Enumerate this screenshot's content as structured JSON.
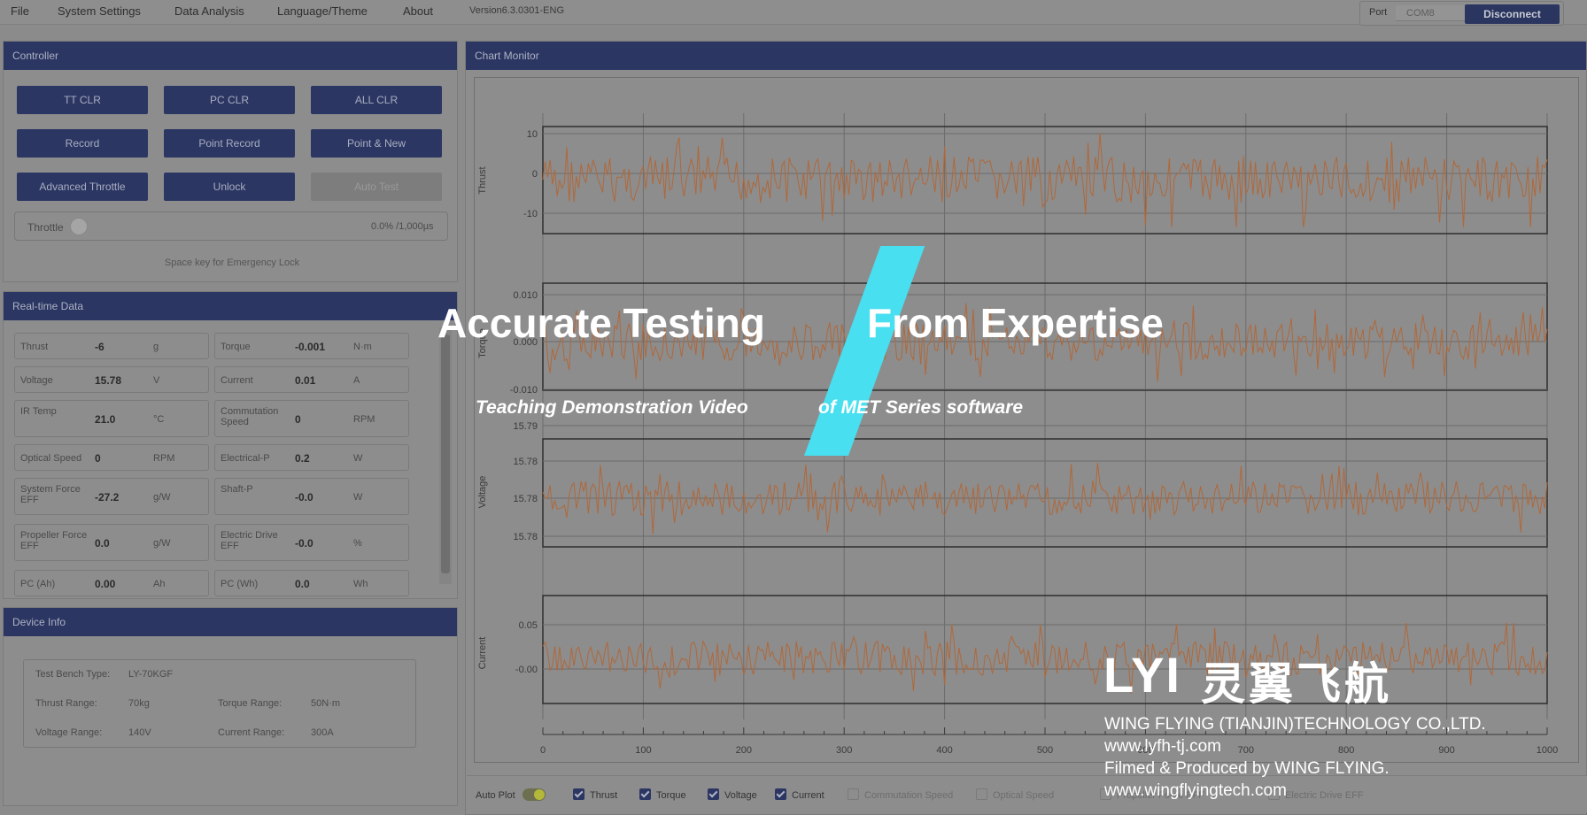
{
  "menu": {
    "file": "File",
    "system_settings": "System Settings",
    "data_analysis": "Data Analysis",
    "language_theme": "Language/Theme",
    "about": "About",
    "version": "Version6.3.0301-ENG"
  },
  "port": {
    "label": "Port",
    "value": "COM8",
    "disconnect": "Disconnect"
  },
  "controller": {
    "title": "Controller",
    "buttons": [
      "TT CLR",
      "PC CLR",
      "ALL CLR",
      "Record",
      "Point Record",
      "Point & New",
      "Advanced Throttle",
      "Unlock",
      "Auto Test"
    ],
    "throttle_label": "Throttle",
    "throttle_value": "0.0%",
    "throttle_max": "/1,000µs",
    "throttle_level": 0.0,
    "hint": "Space key for Emergency Lock"
  },
  "realtime": {
    "title": "Real-time Data",
    "rows": [
      [
        {
          "label": "Thrust",
          "value": "-6",
          "unit": "g"
        },
        {
          "label": "Torque",
          "value": "-0.001",
          "unit": "N·m"
        }
      ],
      [
        {
          "label": "Voltage",
          "value": "15.78",
          "unit": "V"
        },
        {
          "label": "Current",
          "value": "0.01",
          "unit": "A"
        }
      ],
      [
        {
          "label": "IR Temp",
          "value": "21.0",
          "unit": "°C"
        },
        {
          "label": "Commutation Speed",
          "value": "0",
          "unit": "RPM"
        }
      ],
      [
        {
          "label": "Optical Speed",
          "value": "0",
          "unit": "RPM"
        },
        {
          "label": "Electrical-P",
          "value": "0.2",
          "unit": "W"
        }
      ],
      [
        {
          "label": "System Force EFF",
          "value": "-27.2",
          "unit": "g/W"
        },
        {
          "label": "Shaft-P",
          "value": "-0.0",
          "unit": "W"
        }
      ],
      [
        {
          "label": "Propeller Force EFF",
          "value": "0.0",
          "unit": "g/W"
        },
        {
          "label": "Electric Drive EFF",
          "value": "-0.0",
          "unit": "%"
        }
      ],
      [
        {
          "label": "PC (Ah)",
          "value": "0.00",
          "unit": "Ah"
        },
        {
          "label": "PC (Wh)",
          "value": "0.0",
          "unit": "Wh"
        }
      ]
    ]
  },
  "device": {
    "title": "Device Info",
    "bench_type_label": "Test Bench Type:",
    "bench_type": "LY-70KGF",
    "thrust_range_label": "Thrust Range:",
    "thrust_range": "70kg",
    "torque_range_label": "Torque Range:",
    "torque_range": "50N·m",
    "voltage_range_label": "Voltage Range:",
    "voltage_range": "140V",
    "current_range_label": "Current Range:",
    "current_range": "300A"
  },
  "chart_monitor": {
    "title": "Chart Monitor",
    "auto_plot": "Auto Plot",
    "toggles": [
      {
        "label": "Thrust",
        "checked": true
      },
      {
        "label": "Torque",
        "checked": true
      },
      {
        "label": "Voltage",
        "checked": true
      },
      {
        "label": "Current",
        "checked": true
      },
      {
        "label": "Commutation Speed",
        "checked": false
      },
      {
        "label": "Optical Speed",
        "checked": false
      },
      {
        "label": "Propeller Force EFF",
        "checked": false
      },
      {
        "label": "Electric Drive EFF",
        "checked": false
      }
    ]
  },
  "chart_data": [
    {
      "type": "line",
      "ylabel": "Thrust",
      "yticks": [
        "10",
        "0",
        "-10"
      ],
      "ylim": [
        -15,
        15
      ],
      "xlim": [
        0,
        1000
      ],
      "series": [
        {
          "values": "noise around 0, amplitude ~7"
        }
      ]
    },
    {
      "type": "line",
      "ylabel": "Torque",
      "yticks": [
        "0.010",
        "0.000",
        "-0.010"
      ],
      "ylim": [
        -0.012,
        0.012
      ],
      "xlim": [
        0,
        1000
      ],
      "series": [
        {
          "values": "noise around 0.001, amplitude ~0.004"
        }
      ]
    },
    {
      "type": "line",
      "ylabel": "Voltage",
      "yticks": [
        "15.79",
        "15.78",
        "15.78",
        "15.78"
      ],
      "ylim": [
        15.775,
        15.79
      ],
      "xlim": [
        0,
        1000
      ],
      "series": [
        {
          "values": "noise around 15.78"
        }
      ]
    },
    {
      "type": "line",
      "ylabel": "Current",
      "yticks": [
        "0.05",
        "-0.00"
      ],
      "ylim": [
        -0.08,
        0.09
      ],
      "xlim": [
        0,
        1000
      ],
      "series": [
        {
          "values": "noise around 0.01, amplitude ~0.03"
        }
      ]
    }
  ],
  "xticks": [
    "0",
    "100",
    "200",
    "300",
    "400",
    "500",
    "600",
    "700",
    "800",
    "900",
    "1000"
  ],
  "overlay": {
    "title_left": "Accurate Testing",
    "title_right": "From Expertise",
    "sub_left": "Teaching Demonstration Video",
    "sub_right": "of MET Series software",
    "brand_logo": "LYI",
    "brand_cn": "灵翼飞航",
    "company": "WING FLYING (TIANJIN)TECHNOLOGY CO.,LTD.",
    "site1": "www.lyfh-tj.com",
    "credits": "Filmed & Produced by WING FLYING.",
    "site2": "www.wingflyingtech.com"
  },
  "colors": {
    "accent": "#2b3663",
    "plot_line": "#b0683a",
    "slash": "#48dff0"
  }
}
